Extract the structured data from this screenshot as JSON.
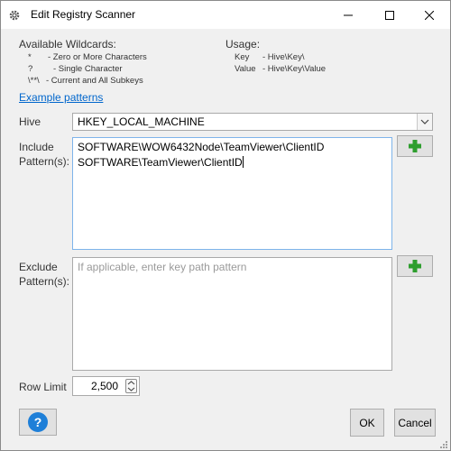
{
  "window": {
    "title": "Edit Registry Scanner",
    "icon": "gear-icon"
  },
  "wildcards": {
    "heading": "Available Wildcards:",
    "items": [
      {
        "symbol": "*",
        "description": "- Zero or More Characters"
      },
      {
        "symbol": "?",
        "description": "- Single Character"
      },
      {
        "symbol": "\\**\\",
        "description": "- Current and All Subkeys"
      }
    ]
  },
  "usage": {
    "heading": "Usage:",
    "items": [
      {
        "key": "Key",
        "value": "- Hive\\Key\\"
      },
      {
        "key": "Value",
        "value": "- Hive\\Key\\Value"
      }
    ]
  },
  "example_link": "Example patterns",
  "hive": {
    "label": "Hive",
    "value": "HKEY_LOCAL_MACHINE"
  },
  "include": {
    "label_line1": "Include",
    "label_line2": "Pattern(s):",
    "lines": [
      "SOFTWARE\\WOW6432Node\\TeamViewer\\ClientID",
      "SOFTWARE\\TeamViewer\\ClientID"
    ]
  },
  "exclude": {
    "label_line1": "Exclude",
    "label_line2": "Pattern(s):",
    "placeholder": "If applicable, enter key path pattern"
  },
  "row_limit": {
    "label": "Row Limit",
    "value": "2,500"
  },
  "buttons": {
    "help": "?",
    "ok": "OK",
    "cancel": "Cancel"
  },
  "colors": {
    "accent_green": "#2e9e2e",
    "help_blue": "#1e7fd8",
    "link_blue": "#0066cc",
    "focus_border": "#7eb4ea"
  }
}
